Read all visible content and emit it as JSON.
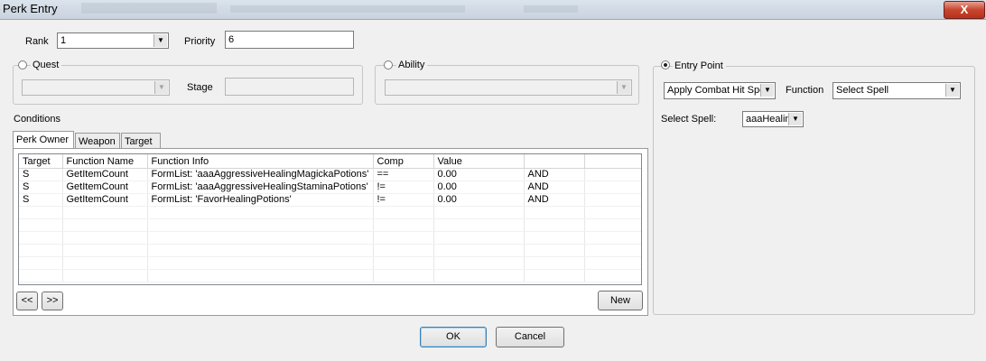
{
  "window": {
    "title": "Perk Entry",
    "close_label": "X"
  },
  "rank": {
    "label": "Rank",
    "value": "1"
  },
  "priority": {
    "label": "Priority",
    "value": "6"
  },
  "quest": {
    "label": "Quest",
    "selected": false,
    "stage_label": "Stage",
    "combo_value": "",
    "stage_value": ""
  },
  "ability": {
    "label": "Ability",
    "selected": false,
    "combo_value": ""
  },
  "entry_point": {
    "label": "Entry Point",
    "selected": true,
    "value": "Apply Combat Hit Spe",
    "function_label": "Function",
    "function_value": "Select Spell",
    "spell_label": "Select Spell:",
    "spell_value": "aaaHealin"
  },
  "conditions": {
    "label": "Conditions",
    "tabs": [
      {
        "label": "Perk Owner",
        "active": true
      },
      {
        "label": "Weapon",
        "active": false
      },
      {
        "label": "Target",
        "active": false
      }
    ],
    "columns": [
      "Target",
      "Function Name",
      "Function Info",
      "Comp",
      "Value",
      ""
    ],
    "rows": [
      {
        "target": "S",
        "function": "GetItemCount",
        "info": "FormList: 'aaaAggressiveHealingMagickaPotions'",
        "comp": "==",
        "value": "0.00",
        "op": "AND"
      },
      {
        "target": "S",
        "function": "GetItemCount",
        "info": "FormList: 'aaaAggressiveHealingStaminaPotions'",
        "comp": "!=",
        "value": "0.00",
        "op": "AND"
      },
      {
        "target": "S",
        "function": "GetItemCount",
        "info": "FormList: 'FavorHealingPotions'",
        "comp": "!=",
        "value": "0.00",
        "op": "AND"
      }
    ],
    "prev_label": "<<",
    "next_label": ">>",
    "new_label": "New"
  },
  "buttons": {
    "ok": "OK",
    "cancel": "Cancel"
  }
}
